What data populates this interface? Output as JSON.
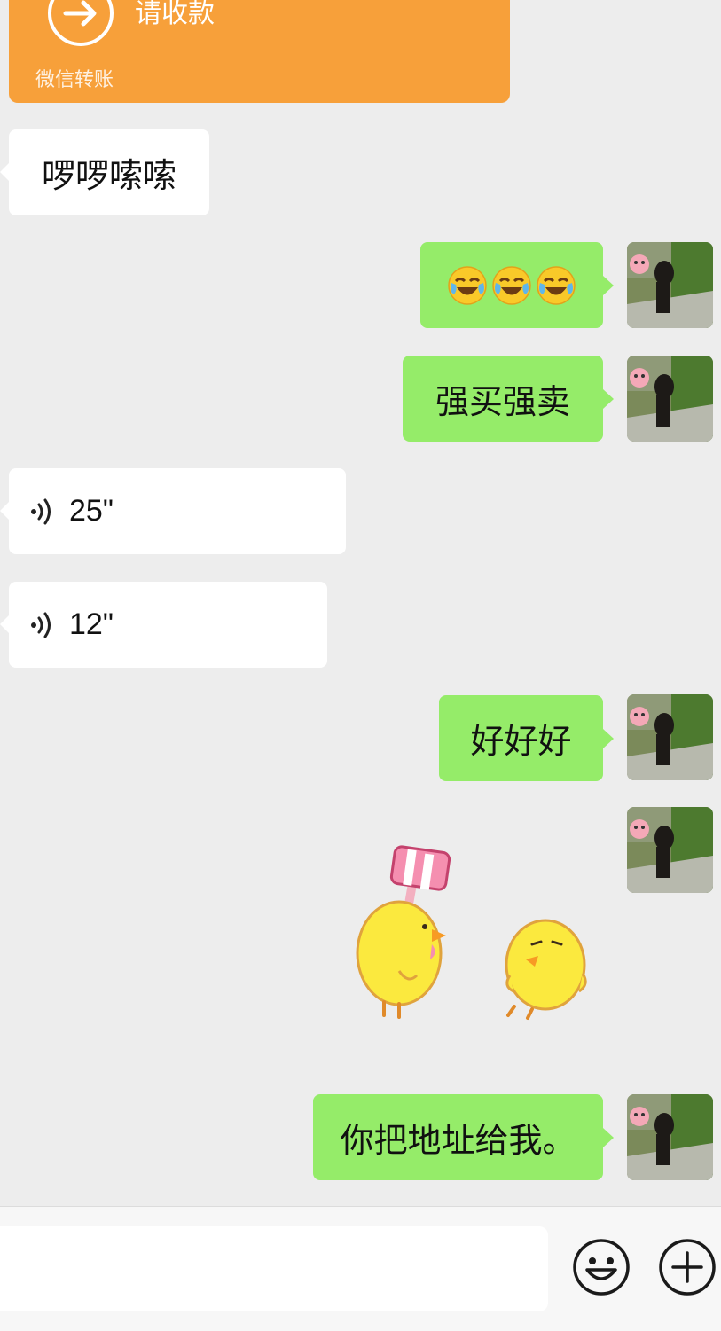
{
  "transfer": {
    "title": "请收款",
    "subtitle": "微信转账",
    "accent": "#f7a03a",
    "icon": "arrow-right-circle-icon"
  },
  "messages": [
    {
      "id": "m1",
      "side": "in",
      "type": "text",
      "text": "啰啰嗦嗦"
    },
    {
      "id": "m2",
      "side": "out",
      "type": "emoji",
      "emoji": [
        "😂",
        "😂",
        "😂"
      ]
    },
    {
      "id": "m3",
      "side": "out",
      "type": "text",
      "text": "强买强卖"
    },
    {
      "id": "m4",
      "side": "in",
      "type": "voice",
      "duration": "25\""
    },
    {
      "id": "m5",
      "side": "in",
      "type": "voice",
      "duration": "12\""
    },
    {
      "id": "m6",
      "side": "out",
      "type": "text",
      "text": "好好好"
    },
    {
      "id": "m7",
      "side": "out",
      "type": "sticker",
      "sticker": "two-yellow-chicks-sticker"
    },
    {
      "id": "m8",
      "side": "out",
      "type": "text",
      "text": "你把地址给我。"
    }
  ],
  "colors": {
    "chat_bg": "#ededed",
    "incoming_bubble": "#ffffff",
    "outgoing_bubble": "#95ec69"
  },
  "input_bar": {
    "input_value": "",
    "emoji_button_icon": "smiley-icon",
    "plus_button_icon": "plus-circle-icon"
  }
}
